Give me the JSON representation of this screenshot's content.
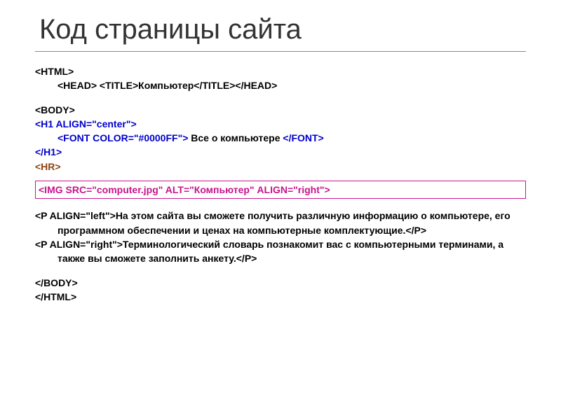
{
  "title": "Код страницы сайта",
  "code": {
    "l1": "<HTML>",
    "l2a": "<HEAD> <TITLE>",
    "l2b": "Компьютер",
    "l2c": "</TITLE></HEAD>",
    "l3": "<BODY>",
    "l4": "<H1 ALIGN=\"center\">",
    "l5a": "<FONT COLOR=\"#0000FF\"> ",
    "l5b": "Все о компьютере ",
    "l5c": "</FONT>",
    "l6": "</H1>",
    "l7": "<HR>",
    "l8": "<IMG SRC=\"computer.jpg\" ALT=\"Компьютер\" ALIGN=\"right\">",
    "p1a": "<P ALIGN=\"left\">",
    "p1b": "На этом сайта вы сможете получить различную информацию  о компьютере, его программном обеспечении и ценах на компьютерные комплектующие.",
    "p1c": "</P>",
    "p2a": "<P ALIGN=\"right\">",
    "p2b": "Терминологический словарь познакомит вас с компьютерными терминами, а также вы сможете заполнить анкету.",
    "p2c": "</P>",
    "l9": "</BODY>",
    "l10": "</HTML>"
  }
}
